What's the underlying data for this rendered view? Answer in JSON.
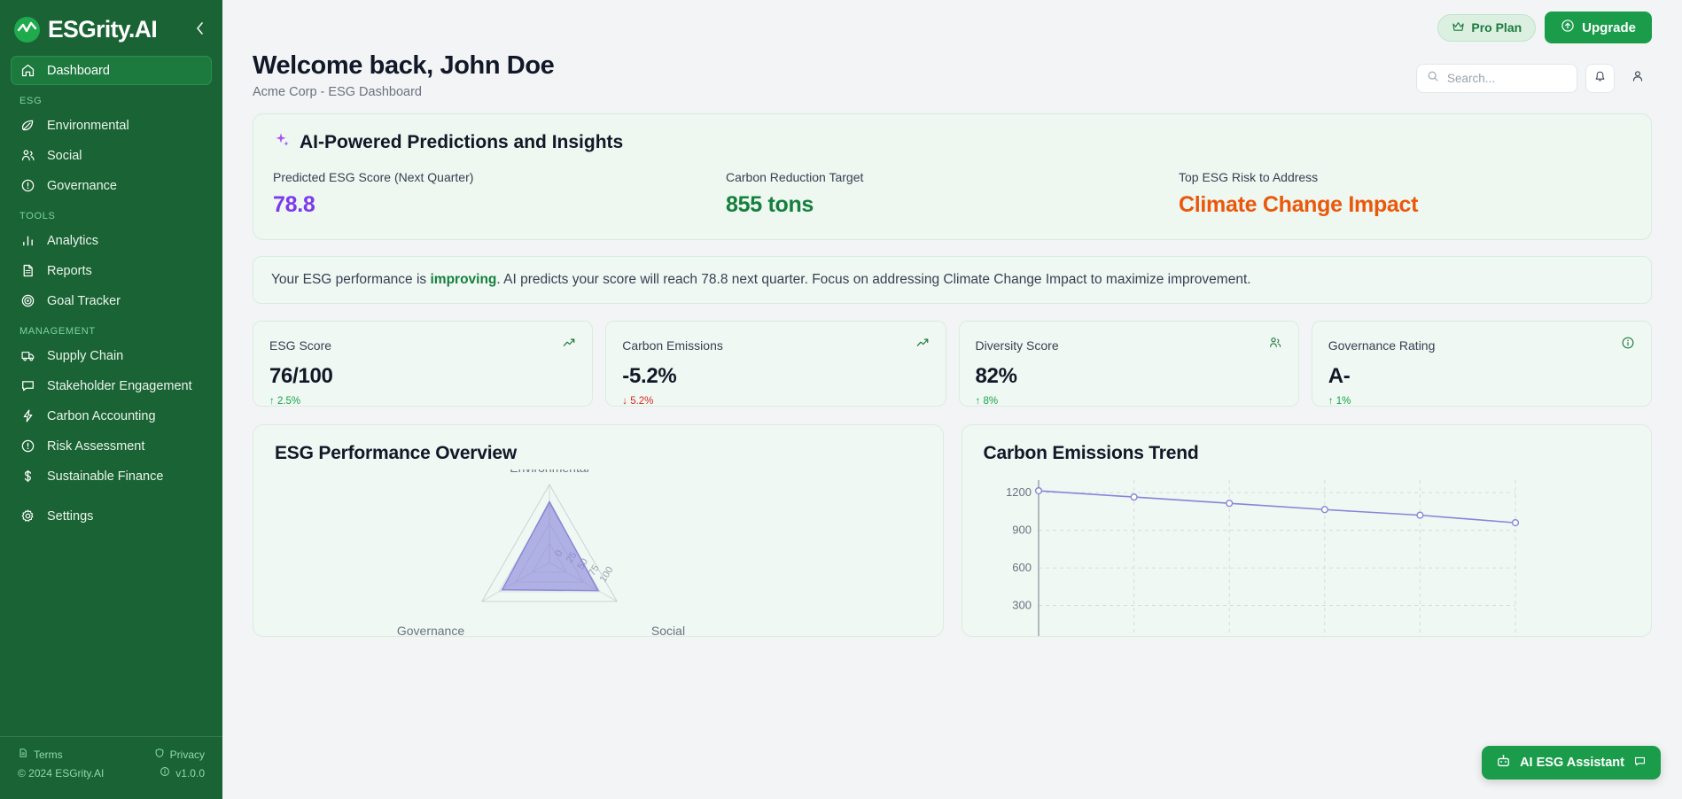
{
  "brand": {
    "name": "ESGrity.AI",
    "collapse_icon": "chevron-left-icon"
  },
  "sidebar": {
    "primary": [
      {
        "label": "Dashboard",
        "icon": "home-icon",
        "active": true
      }
    ],
    "sections": [
      {
        "title": "ESG",
        "items": [
          {
            "label": "Environmental",
            "icon": "leaf-icon"
          },
          {
            "label": "Social",
            "icon": "users-icon"
          },
          {
            "label": "Governance",
            "icon": "alert-circle-icon"
          }
        ]
      },
      {
        "title": "TOOLS",
        "items": [
          {
            "label": "Analytics",
            "icon": "bar-chart-icon"
          },
          {
            "label": "Reports",
            "icon": "document-icon"
          },
          {
            "label": "Goal Tracker",
            "icon": "target-icon"
          }
        ]
      },
      {
        "title": "MANAGEMENT",
        "items": [
          {
            "label": "Supply Chain",
            "icon": "truck-icon"
          },
          {
            "label": "Stakeholder Engagement",
            "icon": "chat-icon"
          },
          {
            "label": "Carbon Accounting",
            "icon": "bolt-icon"
          },
          {
            "label": "Risk Assessment",
            "icon": "alert-circle-icon"
          },
          {
            "label": "Sustainable Finance",
            "icon": "dollar-icon"
          }
        ]
      },
      {
        "title": "",
        "items": [
          {
            "label": "Settings",
            "icon": "gear-icon"
          }
        ]
      }
    ],
    "footer": {
      "terms": "Terms",
      "privacy": "Privacy",
      "copyright": "© 2024 ESGrity.AI",
      "version": "v1.0.0"
    }
  },
  "topbar": {
    "plan_label": "Pro Plan",
    "plan_icon": "crown-icon",
    "upgrade_label": "Upgrade",
    "upgrade_icon": "arrow-up-circle-icon"
  },
  "header": {
    "title": "Welcome back, John Doe",
    "subtitle": "Acme Corp - ESG Dashboard",
    "search_placeholder": "Search...",
    "search_value": "",
    "notification_icon": "bell-icon",
    "profile_icon": "user-icon"
  },
  "ai_panel": {
    "title": "AI-Powered Predictions and Insights",
    "title_icon": "sparkles-icon",
    "items": [
      {
        "label": "Predicted ESG Score (Next Quarter)",
        "value": "78.8",
        "color": "#7c3aed"
      },
      {
        "label": "Carbon Reduction Target",
        "value": "855 tons",
        "color": "#15803d"
      },
      {
        "label": "Top ESG Risk to Address",
        "value": "Climate Change Impact",
        "color": "#ea580c"
      }
    ]
  },
  "banner": {
    "prefix": "Your ESG performance is ",
    "highlight": "improving",
    "suffix": ". AI predicts your score will reach 78.8 next quarter. Focus on addressing Climate Change Impact to maximize improvement."
  },
  "kpis": [
    {
      "label": "ESG Score",
      "value": "76/100",
      "delta": "↑ 2.5%",
      "direction": "up",
      "icon": "trending-up-icon"
    },
    {
      "label": "Carbon Emissions",
      "value": "-5.2%",
      "delta": "↓ 5.2%",
      "direction": "down",
      "icon": "trending-up-icon"
    },
    {
      "label": "Diversity Score",
      "value": "82%",
      "delta": "↑ 8%",
      "direction": "up",
      "icon": "users-icon"
    },
    {
      "label": "Governance Rating",
      "value": "A-",
      "delta": "↑ 1%",
      "direction": "up",
      "icon": "info-circle-icon"
    }
  ],
  "charts": {
    "radar_title": "ESG Performance Overview",
    "line_title": "Carbon Emissions Trend"
  },
  "chart_data": [
    {
      "type": "radar",
      "title": "ESG Performance Overview",
      "categories": [
        "Environmental",
        "Social",
        "Governance"
      ],
      "series": [
        {
          "name": "Score",
          "values": [
            78,
            72,
            70
          ]
        }
      ],
      "tick_labels": [
        "0",
        "25",
        "50",
        "75",
        "100"
      ],
      "range": [
        0,
        100
      ],
      "grid": true,
      "legend": "none",
      "fill_color": "#8884d8"
    },
    {
      "type": "line",
      "title": "Carbon Emissions Trend",
      "x": [
        "1",
        "2",
        "3",
        "4",
        "5",
        "6"
      ],
      "series": [
        {
          "name": "Emissions",
          "values": [
            1215,
            1165,
            1115,
            1065,
            1020,
            960
          ]
        }
      ],
      "ylabel": "",
      "xlabel": "",
      "ytick_labels": [
        "300",
        "600",
        "900",
        "1200"
      ],
      "ylim": [
        0,
        1300
      ],
      "grid": true,
      "legend": "none",
      "line_color": "#8884d8"
    }
  ],
  "fab": {
    "label": "AI ESG Assistant",
    "icon": "bot-icon",
    "badge_icon": "chat-icon"
  }
}
